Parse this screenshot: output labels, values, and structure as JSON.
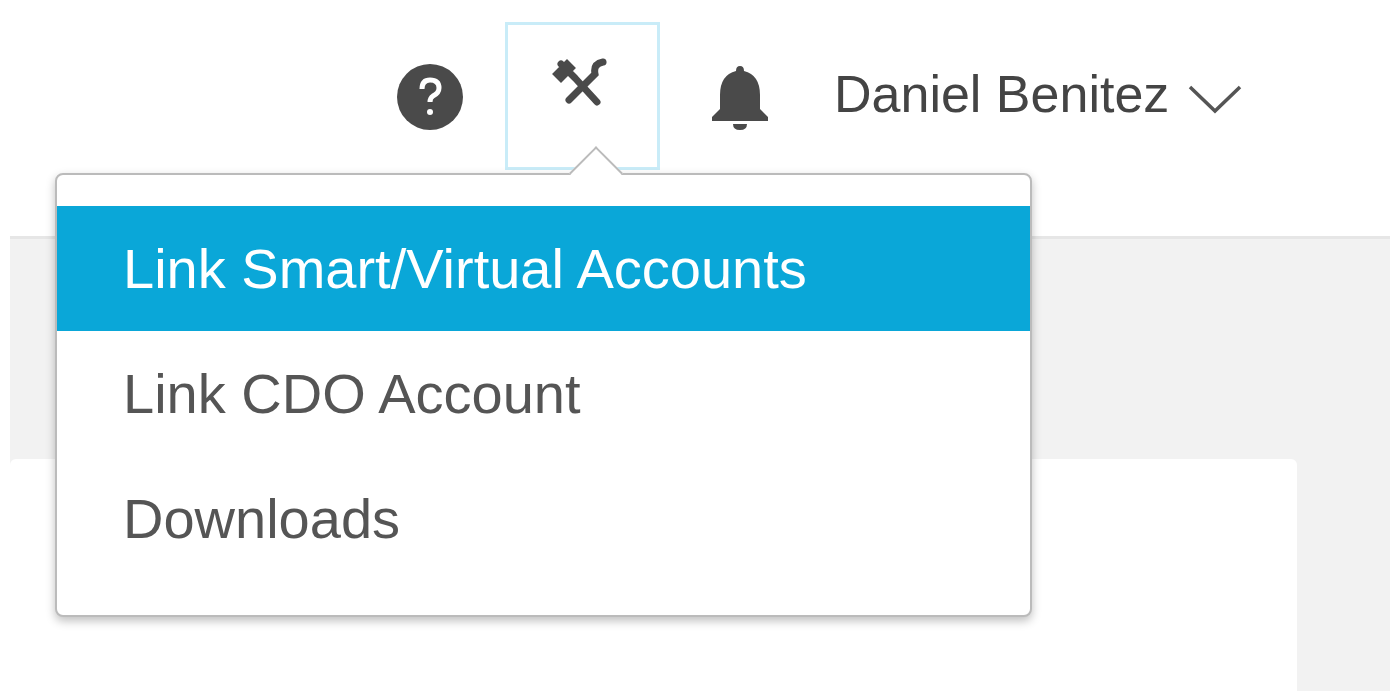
{
  "header": {
    "user": {
      "name": "Daniel Benitez"
    },
    "tools_active": true
  },
  "menu": [
    {
      "label": "Link Smart/Virtual Accounts",
      "selected": true
    },
    {
      "label": "Link CDO Account",
      "selected": false
    },
    {
      "label": "Downloads",
      "selected": false
    }
  ]
}
